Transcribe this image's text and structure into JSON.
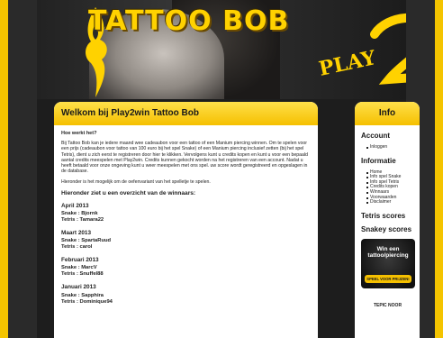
{
  "header": {
    "brand": "TATTOO BOB",
    "logo_text": "PLAY 2 WIN"
  },
  "main": {
    "title": "Welkom bij Play2win Tattoo Bob",
    "question": "Hoe werkt het?",
    "para1": "Bij Tattoo Bob kan je iedere maand wee cadeaubon voor een tattoo of een Manium piercing winnen. Om te spelen voor een prijs (cadeaubon voor tattoo van 100 euro bij het spel Snake) of een Manium piercing inclusief zetten (bij het spel Tetris), dient u zich eerst te registreren door hier te klikken. Vervolgens kunt u credits kopen en kunt u voor een bepaald aantal credits meespelen met Play2win. Credits kunnen gekocht worden na het registreren van een account. Nadat u heeft betaald voor onze ongeving kunt u weer meespelen met ons spel. uw score wordt geregistreerd en opgeslagen in de database.",
    "para2": "Hieronder is het mogelijk om de oefenvariant van het spelletje te spelen.",
    "winners_title": "Hieronder ziet u een overzicht van de winnaars:",
    "months": [
      {
        "month": "April 2013",
        "snake": "Snake : Bjornk",
        "tetris": "Tetris : Tamara22"
      },
      {
        "month": "Maart 2013",
        "snake": "Snake : SpartaRuud",
        "tetris": "Tetris : carol"
      },
      {
        "month": "Februari 2013",
        "snake": "Snake : MarcV",
        "tetris": "Tetris : Snuffel88"
      },
      {
        "month": "Januari 2013",
        "snake": "Snake : Sapphira",
        "tetris": "Tetris : Dominique94"
      }
    ]
  },
  "sidebar": {
    "title": "Info",
    "account_title": "Account",
    "account_items": [
      "Inloggen"
    ],
    "info_title": "Informatie",
    "info_items": [
      "Home",
      "Info spel Snake",
      "Info spel Tetris",
      "Credits kopen",
      "Winnaars",
      "Voorwaarden",
      "Disclaimer"
    ],
    "tetris_scores": "Tetris scores",
    "snakey_scores": "Snakey scores",
    "promo_text": "Win een tattoo/piercing",
    "promo_button": "SPEEL VOOR PRIJZEN!",
    "footer": "TEPIC NOOR"
  },
  "colors": {
    "accent": "#f5c000",
    "frame": "#f4c400",
    "background": "#1d1d1d"
  }
}
